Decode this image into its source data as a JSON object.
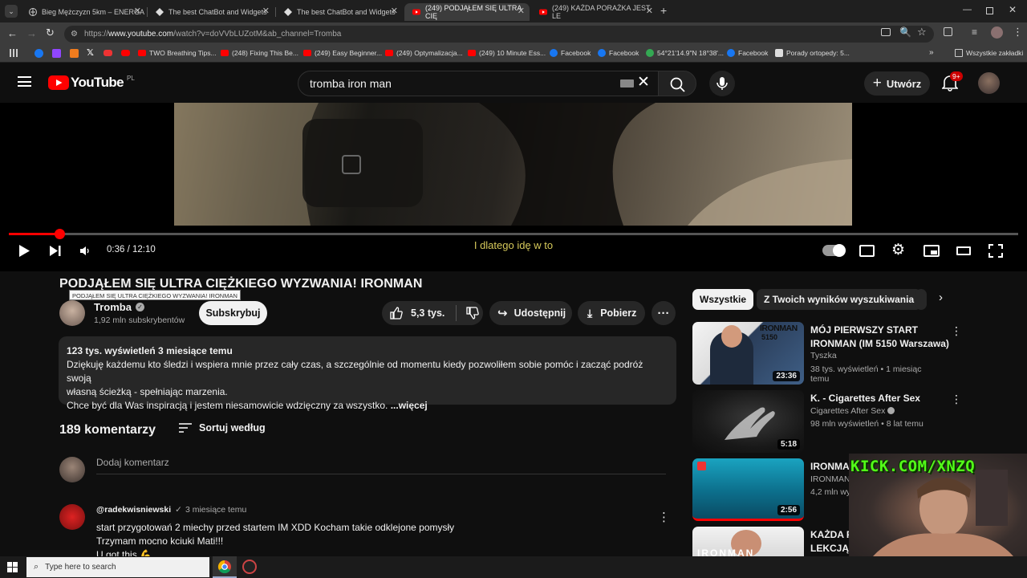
{
  "tabs": [
    {
      "title": "Bieg Mężczyzn 5km – ENERGA",
      "active": false
    },
    {
      "title": "The best ChatBot and Widgets",
      "active": false
    },
    {
      "title": "The best ChatBot and Widgets",
      "active": false
    },
    {
      "title": "(249) PODJĄŁEM SIĘ ULTRA CIĘ",
      "active": true
    },
    {
      "title": "(249) KAŻDA PORAŻKA JEST LE",
      "active": false
    }
  ],
  "address": {
    "prefix": "https://",
    "host": "www.youtube.com",
    "path": "/watch?v=doVVbLUZotM&ab_channel=Tromba"
  },
  "bookmarks": [
    "TWO Breathing Tips...",
    "(248) Fixing This Be...",
    "(249) Easy Beginner...",
    "(249) Optymalizacja...",
    "(249) 10 Minute Ess...",
    "Facebook",
    "Facebook",
    "54°21'14.9\"N 18°38'...",
    "Facebook",
    "Porady ortopedy: 5...",
    "Wszystkie zakładki"
  ],
  "yt": {
    "logo": "YouTube",
    "region": "PL",
    "search_value": "tromba iron man",
    "create": "Utwórz",
    "notif_badge": "9+"
  },
  "player": {
    "time": "0:36 / 12:10",
    "caption": "I dlatego idę w to",
    "progress": 0.05
  },
  "video": {
    "title": "PODJĄŁEM SIĘ ULTRA CIĘŻKIEGO WYZWANIA! IRONMAN",
    "tooltip": "PODJĄŁEM SIĘ ULTRA CIĘŻKIEGO WYZWANIA! IRONMAN",
    "channel": "Tromba",
    "subs": "1,92 mln subskrybentów",
    "subscribe": "Subskrybuj",
    "likes": "5,3 tys.",
    "share": "Udostępnij",
    "download": "Pobierz"
  },
  "description": {
    "stats": "123 tys. wyświetleń  3 miesiące temu",
    "line1": "Dziękuję każdemu kto śledzi i wspiera mnie przez cały czas, a szczególnie od momentu kiedy pozwoliłem sobie pomóc i zacząć podróż swoją",
    "line2": "własną ścieżką - spełniając marzenia.",
    "line3": "Chce być dla Was inspiracją i jestem niesamowicie wdzięczny za wszystko.",
    "more": "...więcej"
  },
  "comments": {
    "count": "189 komentarzy",
    "sort": "Sortuj według",
    "placeholder": "Dodaj komentarz",
    "first": {
      "author": "@radekwisniewski",
      "meta": "3 miesiące temu",
      "line1": "start przygotowań 2 miechy przed startem IM XDD Kocham takie odklejone pomysły",
      "line2": "Trzymam mocno kciuki Mati!!!",
      "line3": "U got this 💪"
    }
  },
  "chips": [
    "Wszystkie",
    "Z Twoich wyników wyszukiwania"
  ],
  "recs": [
    {
      "title": "MÓJ PIERWSZY START IRONMAN (IM 5150 Warszawa)",
      "channel": "Tyszka",
      "meta": "38 tys. wyświetleń • 1 miesiąc temu",
      "duration": "23:36",
      "thumb_text": "IRONMAN",
      "thumb_sub": "5150"
    },
    {
      "title": "K. - Cigarettes After Sex",
      "channel": "Cigarettes After Sex",
      "meta": "98 mln wyświetleń • 8 lat temu",
      "duration": "5:18"
    },
    {
      "title": "IRONMAN",
      "channel": "IRONMAN T",
      "meta": "4,2 mln wyś",
      "duration": "2:56"
    },
    {
      "title": "KAŻDA PO",
      "title2": "LEKCJĄ...",
      "thumb_text": "IRONMAN"
    }
  ],
  "overlay": {
    "kick": "KICK.COM/XNZQ"
  },
  "taskbar": {
    "search_placeholder": "Type here to search"
  }
}
